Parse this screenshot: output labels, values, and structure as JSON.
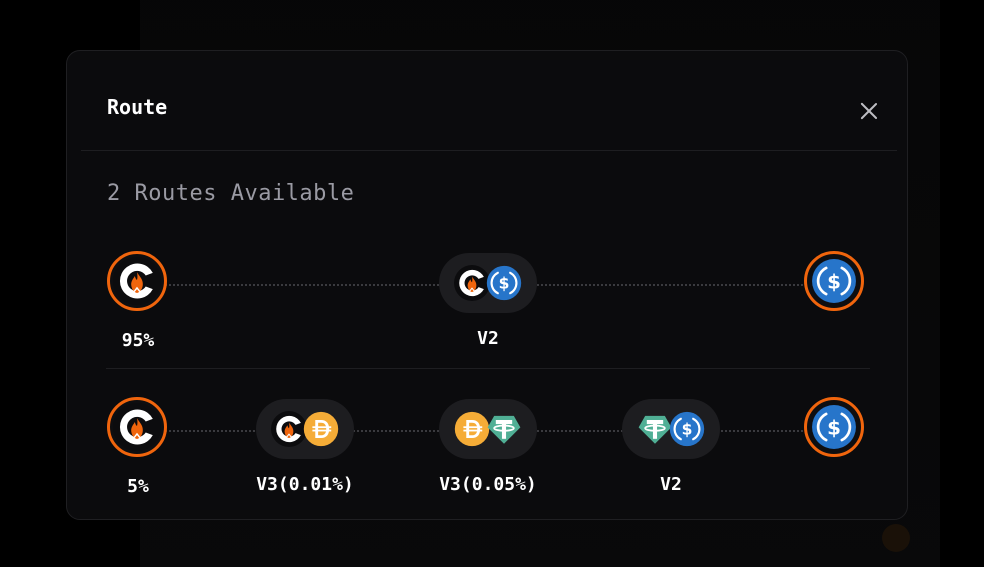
{
  "modal": {
    "title": "Route",
    "routes_available": "2 Routes Available"
  },
  "routes": [
    {
      "share": "95%",
      "from_token": "c-flame-token-icon",
      "to_token": "usdc-icon",
      "pools": [
        {
          "label": "V2",
          "tokens": [
            "c-flame-token-icon",
            "usdc-icon"
          ]
        }
      ]
    },
    {
      "share": "5%",
      "from_token": "c-flame-token-icon",
      "to_token": "usdc-icon",
      "pools": [
        {
          "label": "V3(0.01%)",
          "tokens": [
            "c-flame-token-icon",
            "dai-icon"
          ]
        },
        {
          "label": "V3(0.05%)",
          "tokens": [
            "dai-icon",
            "usdt-icon"
          ]
        },
        {
          "label": "V2",
          "tokens": [
            "usdt-icon",
            "usdc-icon"
          ]
        }
      ]
    }
  ],
  "colors": {
    "accent": "#f0650d",
    "usdc": "#2775ca",
    "dai": "#f5ac37",
    "usdt": "#50af95"
  }
}
